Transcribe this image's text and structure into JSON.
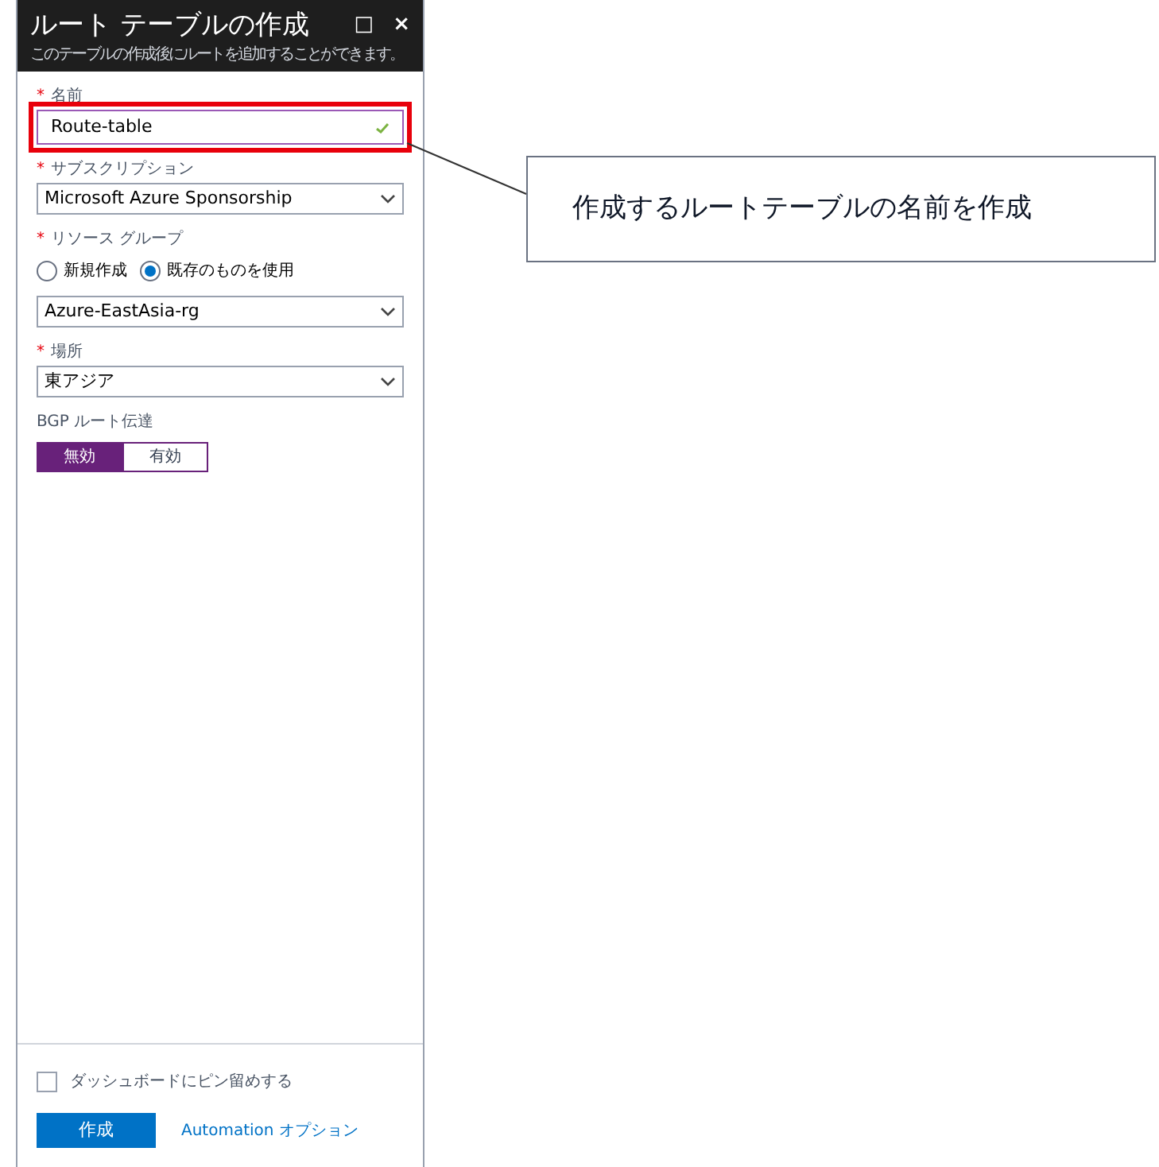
{
  "blade": {
    "title": "ルート テーブルの作成",
    "subtitle": "このテーブルの作成後にルートを追加することができます。",
    "buttons": [
      "□",
      "×"
    ]
  },
  "fields": [
    {
      "kind": "text",
      "label": "名前",
      "required_mark": "*",
      "value": "Route-table",
      "valid": true,
      "highlighted": true
    },
    {
      "kind": "select",
      "label": "サブスクリプション",
      "required_mark": "*",
      "value": "Microsoft Azure Sponsorship"
    },
    {
      "kind": "radio",
      "label": "リソース グループ",
      "required_mark": "*",
      "options": [
        {
          "label": "新規作成",
          "selected": false
        },
        {
          "label": "既存のものを使用",
          "selected": true
        }
      ]
    },
    {
      "kind": "select",
      "value": "Azure-EastAsia-rg"
    },
    {
      "kind": "select",
      "label": "場所",
      "required_mark": "*",
      "value": "東アジア"
    },
    {
      "kind": "toggle",
      "label": "BGP ルート伝達",
      "options": [
        {
          "label": "無効",
          "selected": true
        },
        {
          "label": "有効",
          "selected": false
        }
      ]
    }
  ],
  "footer": {
    "pin": {
      "label": "ダッシュボードにピン留めする",
      "checked": false
    },
    "create_button": "作成",
    "automation_link": "Automation オプション"
  },
  "callout": {
    "text": "作成するルートテーブルの名前を作成"
  }
}
